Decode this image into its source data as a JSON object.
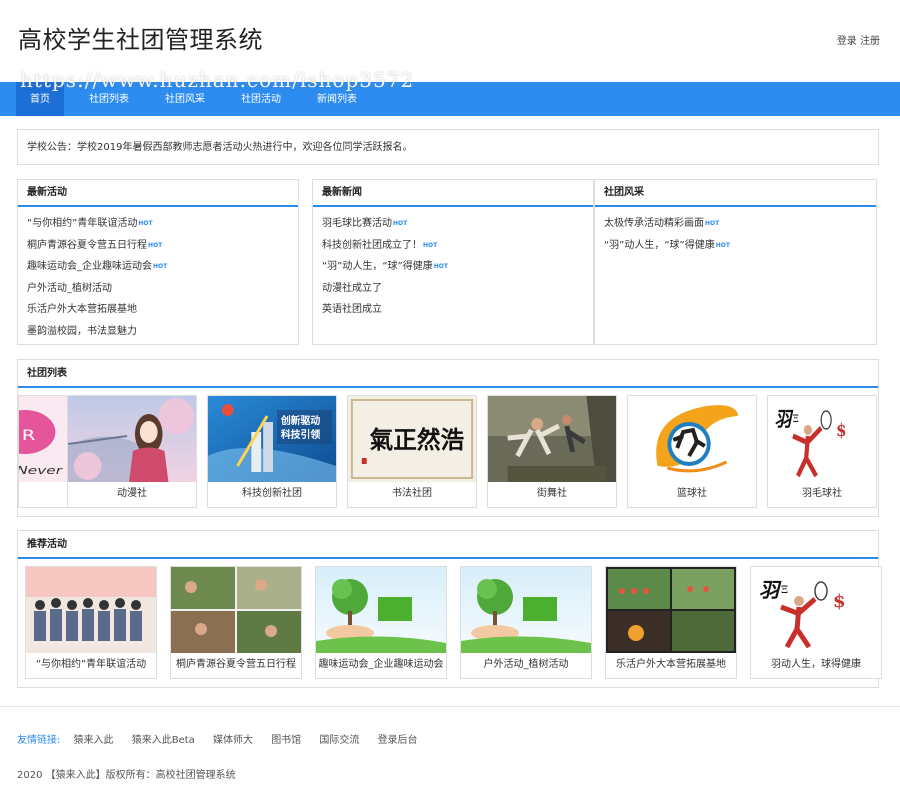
{
  "site": {
    "title": "高校学生社团管理系统",
    "login": "登录",
    "register": "注册",
    "watermark": "https://www.huzhan.com/ishop3572"
  },
  "nav": {
    "items": [
      "首页",
      "社团列表",
      "社团风采",
      "社团活动",
      "新闻列表"
    ],
    "active": 0
  },
  "notice": "学校公告：学校2019年暑假西部教师志愿者活动火热进行中，欢迎各位同学活跃报名。",
  "hot_label": "HOT",
  "latest_activities": {
    "title": "最新活动",
    "items": [
      {
        "text": "“与你相约”青年联谊活动",
        "hot": true
      },
      {
        "text": "桐庐青源谷夏令营五日行程",
        "hot": true
      },
      {
        "text": "趣味运动会_企业趣味运动会",
        "hot": true
      },
      {
        "text": "户外活动_植树活动",
        "hot": false
      },
      {
        "text": "乐活户外大本营拓展基地",
        "hot": false
      },
      {
        "text": "墨韵溢校园，书法显魅力",
        "hot": false
      }
    ]
  },
  "latest_news": {
    "title": "最新新闻",
    "items": [
      {
        "text": "羽毛球比赛活动",
        "hot": true
      },
      {
        "text": "科技创新社团成立了！",
        "hot": true
      },
      {
        "text": "“羽”动人生，“球”得健康",
        "hot": true
      },
      {
        "text": "动漫社成立了",
        "hot": false
      },
      {
        "text": "英语社团成立",
        "hot": false
      }
    ]
  },
  "club_style": {
    "title": "社团风采",
    "items": [
      {
        "text": "太极传承活动精彩画面",
        "hot": true
      },
      {
        "text": "“羽”动人生，“球”得健康",
        "hot": true
      }
    ]
  },
  "club_list": {
    "title": "社团列表",
    "items": [
      {
        "name": "",
        "thumb": "never-logo"
      },
      {
        "name": "动漫社",
        "thumb": "anime-girl"
      },
      {
        "name": "科技创新社团",
        "thumb": "tech-poster",
        "image_text": [
          "创新驱动",
          "科技引领"
        ]
      },
      {
        "name": "书法社团",
        "thumb": "calligraphy",
        "image_text": [
          "氣正然浩"
        ]
      },
      {
        "name": "街舞社",
        "thumb": "street-dance"
      },
      {
        "name": "篮球社",
        "thumb": "basketball"
      },
      {
        "name": "羽毛球社",
        "thumb": "badminton"
      }
    ]
  },
  "recommended": {
    "title": "推荐活动",
    "items": [
      {
        "name": "“与你相约”青年联谊活动",
        "thumb": "group-photo"
      },
      {
        "name": "桐庐青源谷夏令营五日行程",
        "thumb": "camp-collage"
      },
      {
        "name": "趣味运动会_企业趣味运动会",
        "thumb": "tree-planting"
      },
      {
        "name": "户外活动_植树活动",
        "thumb": "tree-planting"
      },
      {
        "name": "乐活户外大本营拓展基地",
        "thumb": "outdoor-collage"
      },
      {
        "name": "羽动人生，球得健康",
        "thumb": "badminton"
      }
    ]
  },
  "footer": {
    "links_label": "友情链接:",
    "links": [
      "猿来入此",
      "猿来入此Beta",
      "媒体师大",
      "图书馆",
      "国际交流",
      "登录后台"
    ],
    "copyright": "2020 【猿来入此】版权所有：高校社团管理系统"
  },
  "colors": {
    "primary": "#2d8cf0",
    "hot": "#2d8cf0",
    "border": "#dddddd"
  }
}
